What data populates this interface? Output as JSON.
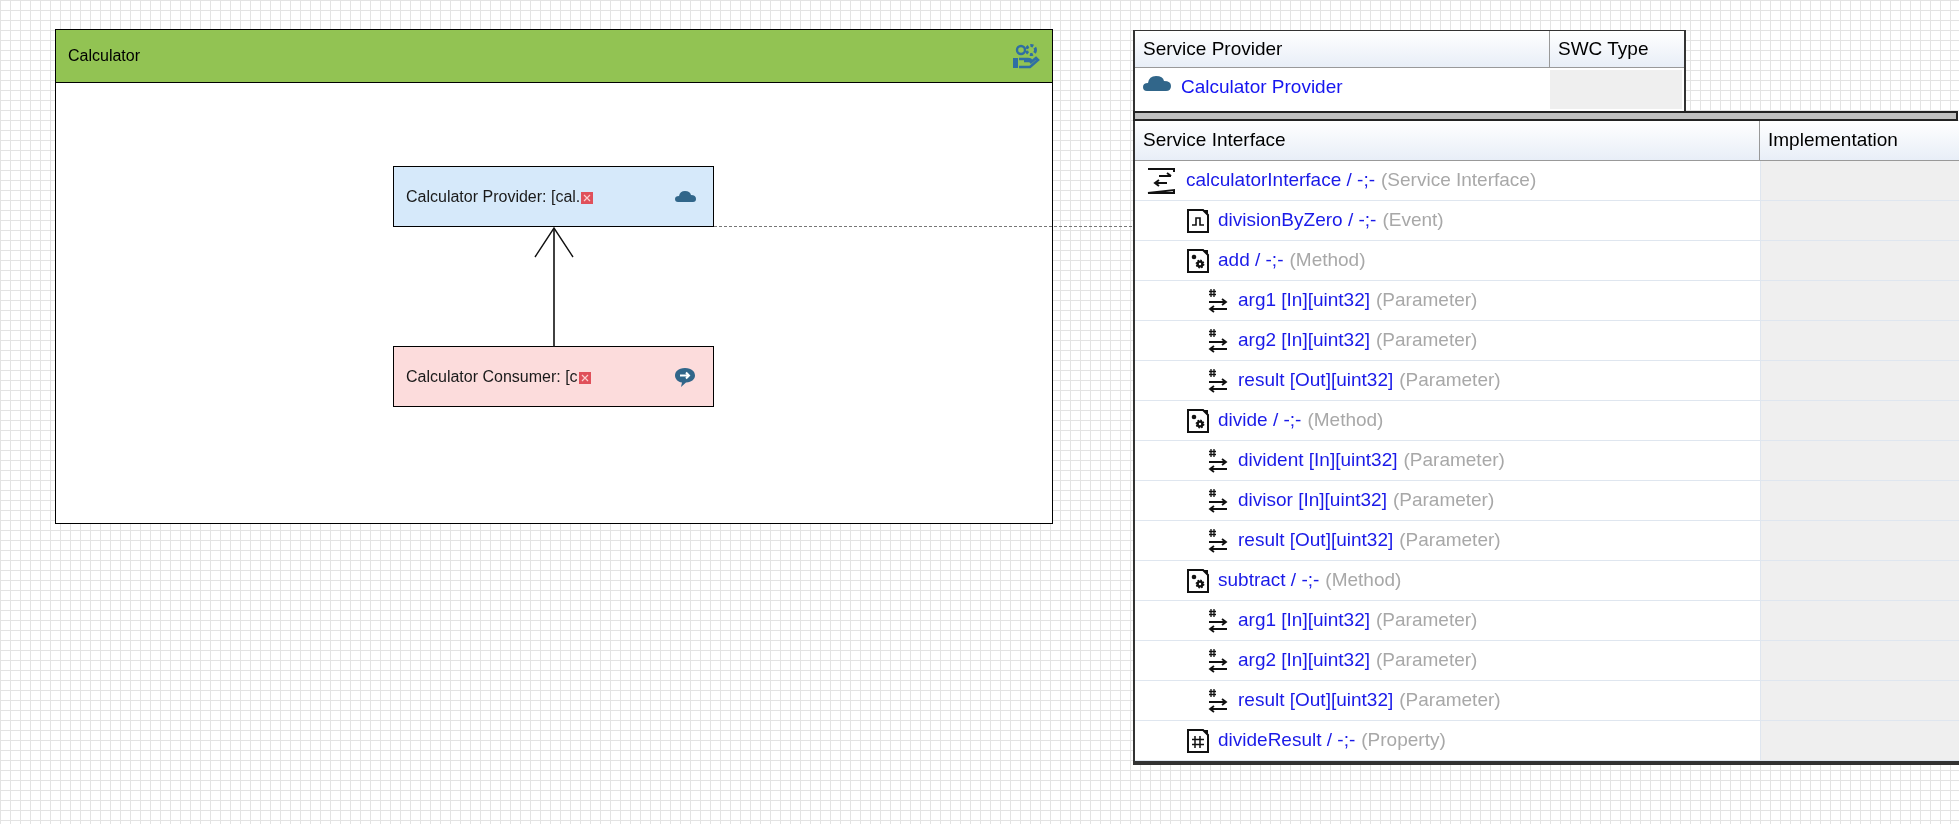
{
  "package": {
    "title": "Calculator"
  },
  "components": [
    {
      "kind": "provider",
      "label": "Calculator Provider: [cal."
    },
    {
      "kind": "consumer",
      "label": "Calculator Consumer: [c"
    }
  ],
  "provider_table": {
    "columns": [
      "Service Provider",
      "SWC Type"
    ],
    "rows": [
      {
        "name": "Calculator Provider"
      }
    ]
  },
  "interface_table": {
    "columns": [
      "Service Interface",
      "Implementation"
    ],
    "tree": [
      {
        "kind": "interface",
        "label": "calculatorInterface / -;-",
        "type": "(Service Interface)",
        "children": [
          {
            "kind": "event",
            "label": "divisionByZero / -;-",
            "type": "(Event)"
          },
          {
            "kind": "method",
            "label": "add / -;-",
            "type": "(Method)",
            "children": [
              {
                "kind": "parameter",
                "label": "arg1 [In][uint32]",
                "type": "(Parameter)"
              },
              {
                "kind": "parameter",
                "label": "arg2 [In][uint32]",
                "type": "(Parameter)"
              },
              {
                "kind": "parameter",
                "label": "result [Out][uint32]",
                "type": "(Parameter)"
              }
            ]
          },
          {
            "kind": "method",
            "label": "divide / -;-",
            "type": "(Method)",
            "children": [
              {
                "kind": "parameter",
                "label": "divident [In][uint32]",
                "type": "(Parameter)"
              },
              {
                "kind": "parameter",
                "label": "divisor [In][uint32]",
                "type": "(Parameter)"
              },
              {
                "kind": "parameter",
                "label": "result [Out][uint32]",
                "type": "(Parameter)"
              }
            ]
          },
          {
            "kind": "method",
            "label": "subtract / -;-",
            "type": "(Method)",
            "children": [
              {
                "kind": "parameter",
                "label": "arg1 [In][uint32]",
                "type": "(Parameter)"
              },
              {
                "kind": "parameter",
                "label": "arg2 [In][uint32]",
                "type": "(Parameter)"
              },
              {
                "kind": "parameter",
                "label": "result [Out][uint32]",
                "type": "(Parameter)"
              }
            ]
          },
          {
            "kind": "property",
            "label": "divideResult / -;-",
            "type": "(Property)"
          }
        ]
      }
    ]
  }
}
